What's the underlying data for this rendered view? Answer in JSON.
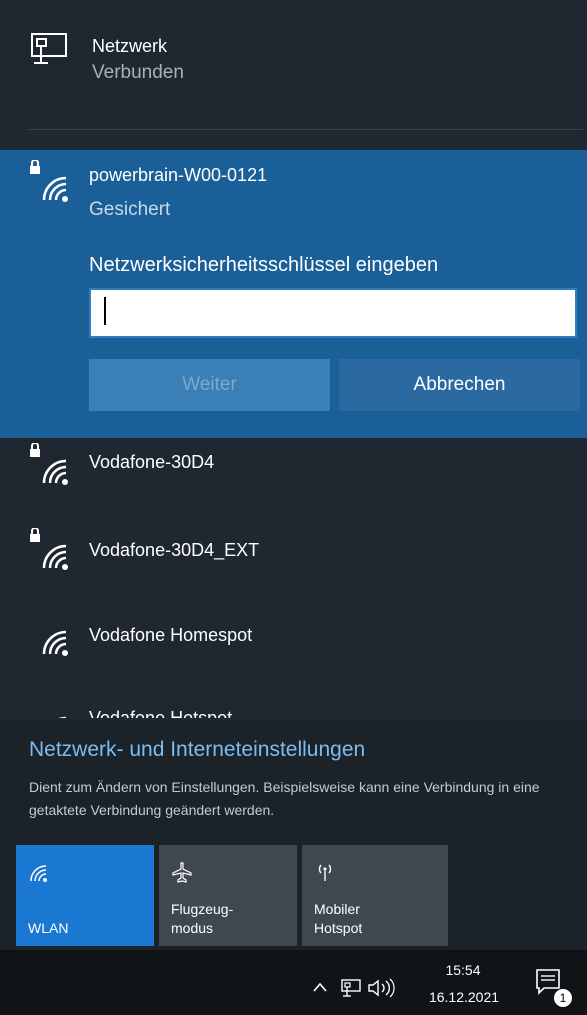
{
  "wired": {
    "name": "Netzwerk",
    "status": "Verbunden",
    "icon": "ethernet-icon"
  },
  "selected_network": {
    "name": "powerbrain-W00-0121",
    "status": "Gesichert",
    "key_label": "Netzwerksicherheitsschlüssel eingeben",
    "key_value": "",
    "next_label": "Weiter",
    "cancel_label": "Abbrechen",
    "icon": "wifi-secured-icon"
  },
  "networks": [
    {
      "name": "Vodafone-30D4",
      "secured": true
    },
    {
      "name": "Vodafone-30D4_EXT",
      "secured": true
    },
    {
      "name": "Vodafone Homespot",
      "secured": false
    },
    {
      "name": "Vodafone Hotspot",
      "secured": false
    }
  ],
  "settings": {
    "link": "Netzwerk- und Interneteinstellungen",
    "description": "Dient zum Ändern von Einstellungen. Beispielsweise kann eine Verbindung in eine getaktete Verbindung geändert werden."
  },
  "tiles": [
    {
      "label": "WLAN",
      "icon": "wifi-icon",
      "active": true
    },
    {
      "label": "Flugzeug-\nmodus",
      "icon": "airplane-icon",
      "active": false
    },
    {
      "label": "Mobiler\nHotspot",
      "icon": "hotspot-icon",
      "active": false
    }
  ],
  "taskbar": {
    "time": "15:54",
    "date": "16.12.2021",
    "notifications": "1"
  },
  "colors": {
    "accent": "#1a78d2",
    "panel": "#1a5f98",
    "background": "#1f2830",
    "link": "#7cbcf0"
  }
}
